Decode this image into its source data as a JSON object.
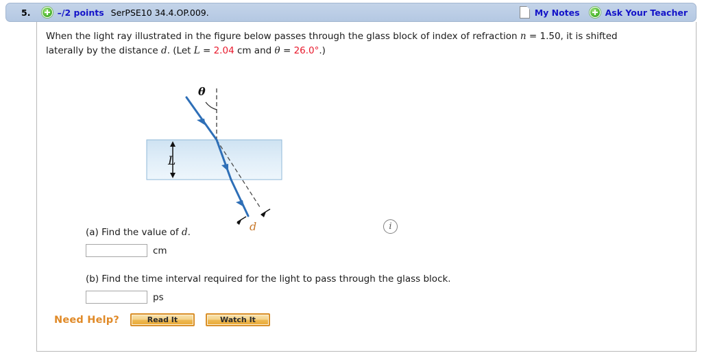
{
  "header": {
    "question_number": "5.",
    "plus_icon": "plus-circle-icon",
    "points": "–/2 points",
    "question_code": "SerPSE10 34.4.OP.009.",
    "notes_icon": "page-icon",
    "my_notes_label": "My Notes",
    "ask_plus_icon": "plus-circle-icon",
    "ask_teacher_label": "Ask Your Teacher",
    "link_color": "#1414c8",
    "bar_color": "#bccee6"
  },
  "question": {
    "line1_part1": "When the light ray illustrated in the figure below passes through the glass block of index of refraction ",
    "n_symbol": "n",
    "n_value": " = 1.50, it is shifted",
    "line2_part1": "laterally by the distance ",
    "d_symbol": "d",
    "line2_part2": ". (Let ",
    "L_symbol": "L",
    "L_eq": " = ",
    "L_value": "2.04",
    "L_unit": " cm and ",
    "theta_symbol": "θ",
    "theta_eq": " = ",
    "theta_value": "26.0°",
    "line2_end": ".)",
    "highlight_color": "#e8192c"
  },
  "figure": {
    "name": "light-ray-through-glass-block-diagram",
    "theta_label": "θ",
    "L_label": "L",
    "d_label": "d",
    "block_fill_top": "#cfe3f2",
    "block_fill_bottom": "#eaf4fb",
    "block_border": "#8fb8d8",
    "ray_color": "#2e6fb7",
    "d_label_color": "#c8782a",
    "normal_line": "dashed-vertical-normal",
    "undeviated_line": "dashed-undeviated-ray"
  },
  "info_icon": {
    "glyph": "i",
    "name": "info-icon"
  },
  "parts": [
    {
      "label": "(a) Find the value of ",
      "variable": "d",
      "label_end": ".",
      "input_value": "",
      "input_placeholder": "",
      "unit": "cm"
    },
    {
      "label": "(b) Find the time interval required for the light to pass through the glass block.",
      "variable": "",
      "label_end": "",
      "input_value": "",
      "input_placeholder": "",
      "unit": "ps"
    }
  ],
  "need_help": {
    "label": "Need Help?",
    "label_color": "#e08a28",
    "buttons": [
      {
        "label": "Read It",
        "name": "read-it-button"
      },
      {
        "label": "Watch It",
        "name": "watch-it-button"
      }
    ]
  }
}
